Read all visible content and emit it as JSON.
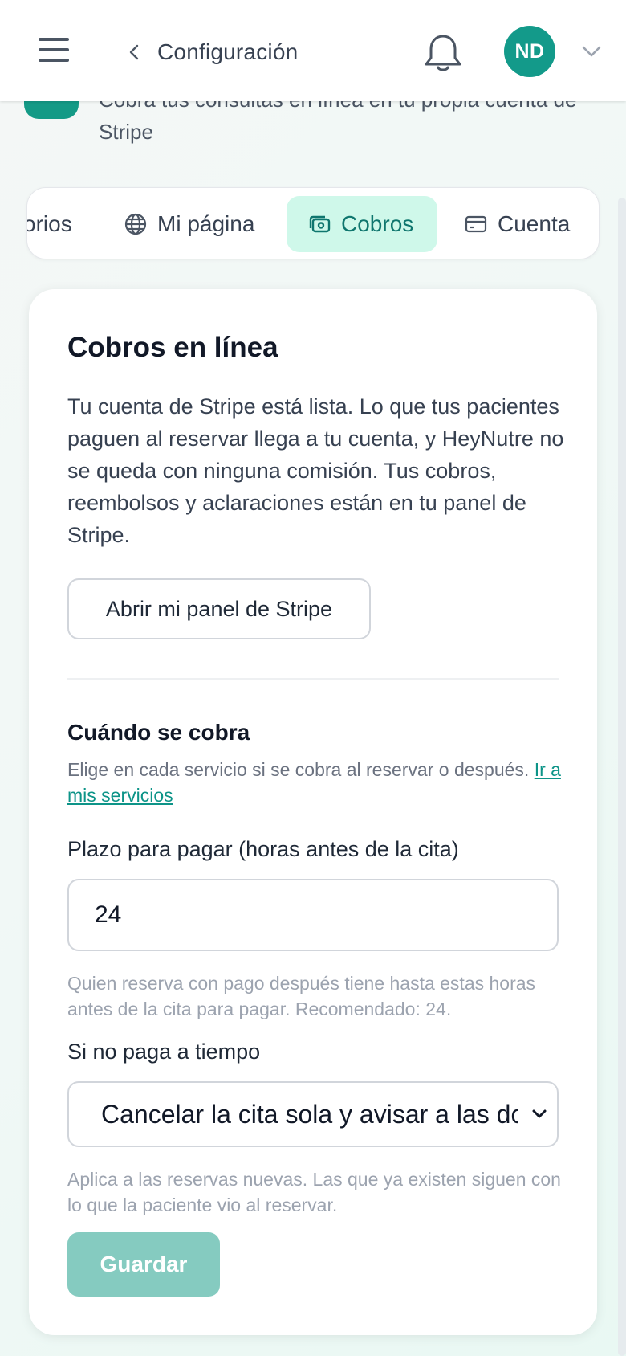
{
  "header": {
    "back_title": "Configuración",
    "avatar_initials": "ND",
    "avatar_color": "#139a8a"
  },
  "banner": {
    "text": "Cobra tus consultas en línea en tu propia cuenta de Stripe"
  },
  "tabs": [
    {
      "label": "orios",
      "icon": "",
      "active": false
    },
    {
      "label": "Mi página",
      "icon": "globe-icon",
      "active": false
    },
    {
      "label": "Cobros",
      "icon": "money-icon",
      "active": true
    },
    {
      "label": "Cuenta",
      "icon": "credit-card-icon",
      "active": false
    }
  ],
  "card": {
    "title": "Cobros en línea",
    "description": "Tu cuenta de Stripe está lista. Lo que tus pacientes paguen al reservar llega a tu cuenta, y HeyNutre no se queda con ninguna comisión. Tus cobros, reembolsos y aclaraciones están en tu panel de Stripe.",
    "stripe_button": "Abrir mi panel de Stripe",
    "when_heading": "Cuándo se cobra",
    "when_help": "Elige en cada servicio si se cobra al reservar o después.",
    "services_link": "Ir a mis servicios",
    "deadline_label": "Plazo para pagar (horas antes de la cita)",
    "deadline_value": "24",
    "deadline_hint": "Quien reserva con pago después tiene hasta estas horas antes de la cita para pagar. Recomendado: 24.",
    "late_label": "Si no paga a tiempo",
    "late_selected": "Cancelar la cita sola y avisar a las dos",
    "late_hint": "Aplica a las reservas nuevas. Las que ya existen siguen con lo que la paciente vio al reservar.",
    "save_button": "Guardar"
  },
  "colors": {
    "accent": "#139a8a",
    "active_tab_bg": "#cff8ea",
    "link": "#0d9488",
    "save_disabled": "#85cbc0"
  }
}
